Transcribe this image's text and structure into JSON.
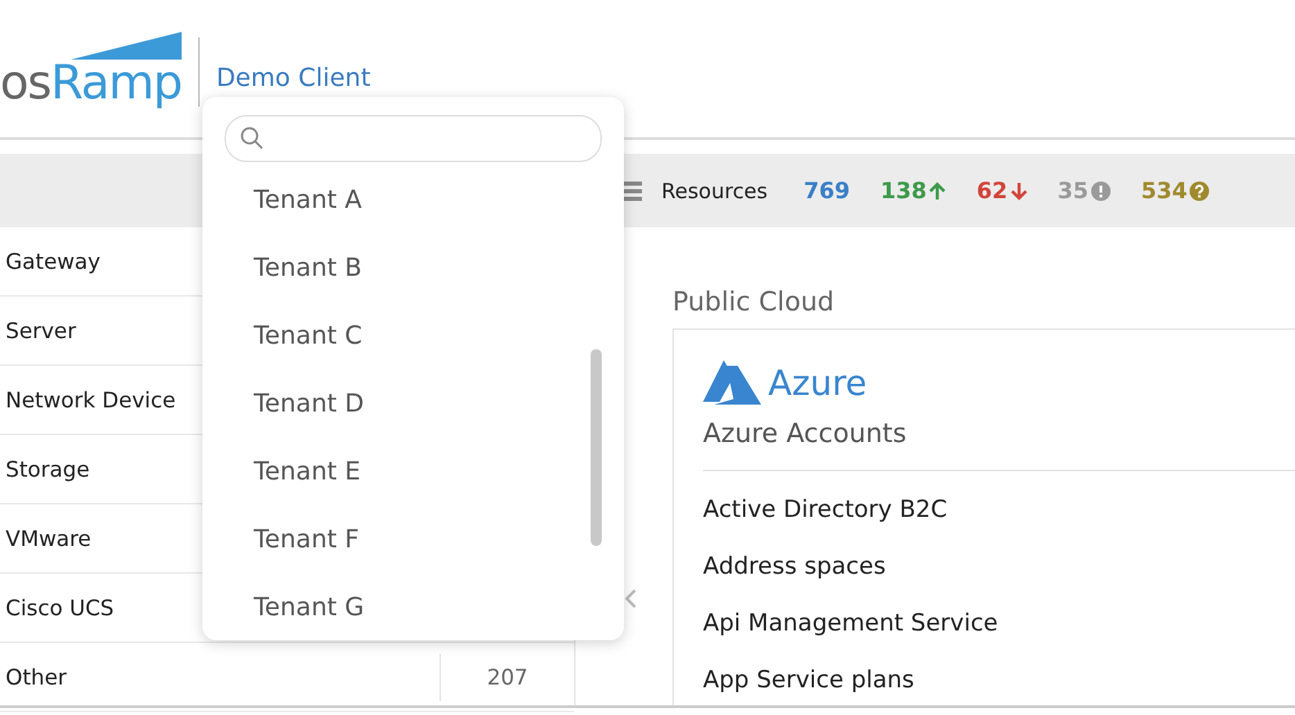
{
  "header": {
    "logo_prefix": "os",
    "logo_name": "Ramp",
    "client": "Demo Client"
  },
  "summary": {
    "label": "Resources",
    "counts": [
      {
        "kind": "total",
        "value": "769",
        "color": "#3a7fc8"
      },
      {
        "kind": "up",
        "value": "138",
        "color": "#3d9a4a"
      },
      {
        "kind": "down",
        "value": "62",
        "color": "#d2453a"
      },
      {
        "kind": "info",
        "value": "35",
        "color": "#9a9a9a"
      },
      {
        "kind": "unknown",
        "value": "534",
        "color": "#a08a2e"
      }
    ]
  },
  "device_types": [
    {
      "name": "Gateway"
    },
    {
      "name": "Server"
    },
    {
      "name": "Network Device"
    },
    {
      "name": "Storage"
    },
    {
      "name": "VMware"
    },
    {
      "name": "Cisco UCS"
    },
    {
      "name": "Other",
      "count": "207"
    }
  ],
  "public_cloud": {
    "title": "Public Cloud",
    "provider": "Azure",
    "accounts_title": "Azure Accounts",
    "services": [
      "Active Directory B2C",
      "Address spaces",
      "Api Management Service",
      "App Service plans"
    ]
  },
  "tenant_dropdown": {
    "tenants": [
      "Tenant A",
      "Tenant B",
      "Tenant C",
      "Tenant D",
      "Tenant E",
      "Tenant F",
      "Tenant G"
    ]
  }
}
